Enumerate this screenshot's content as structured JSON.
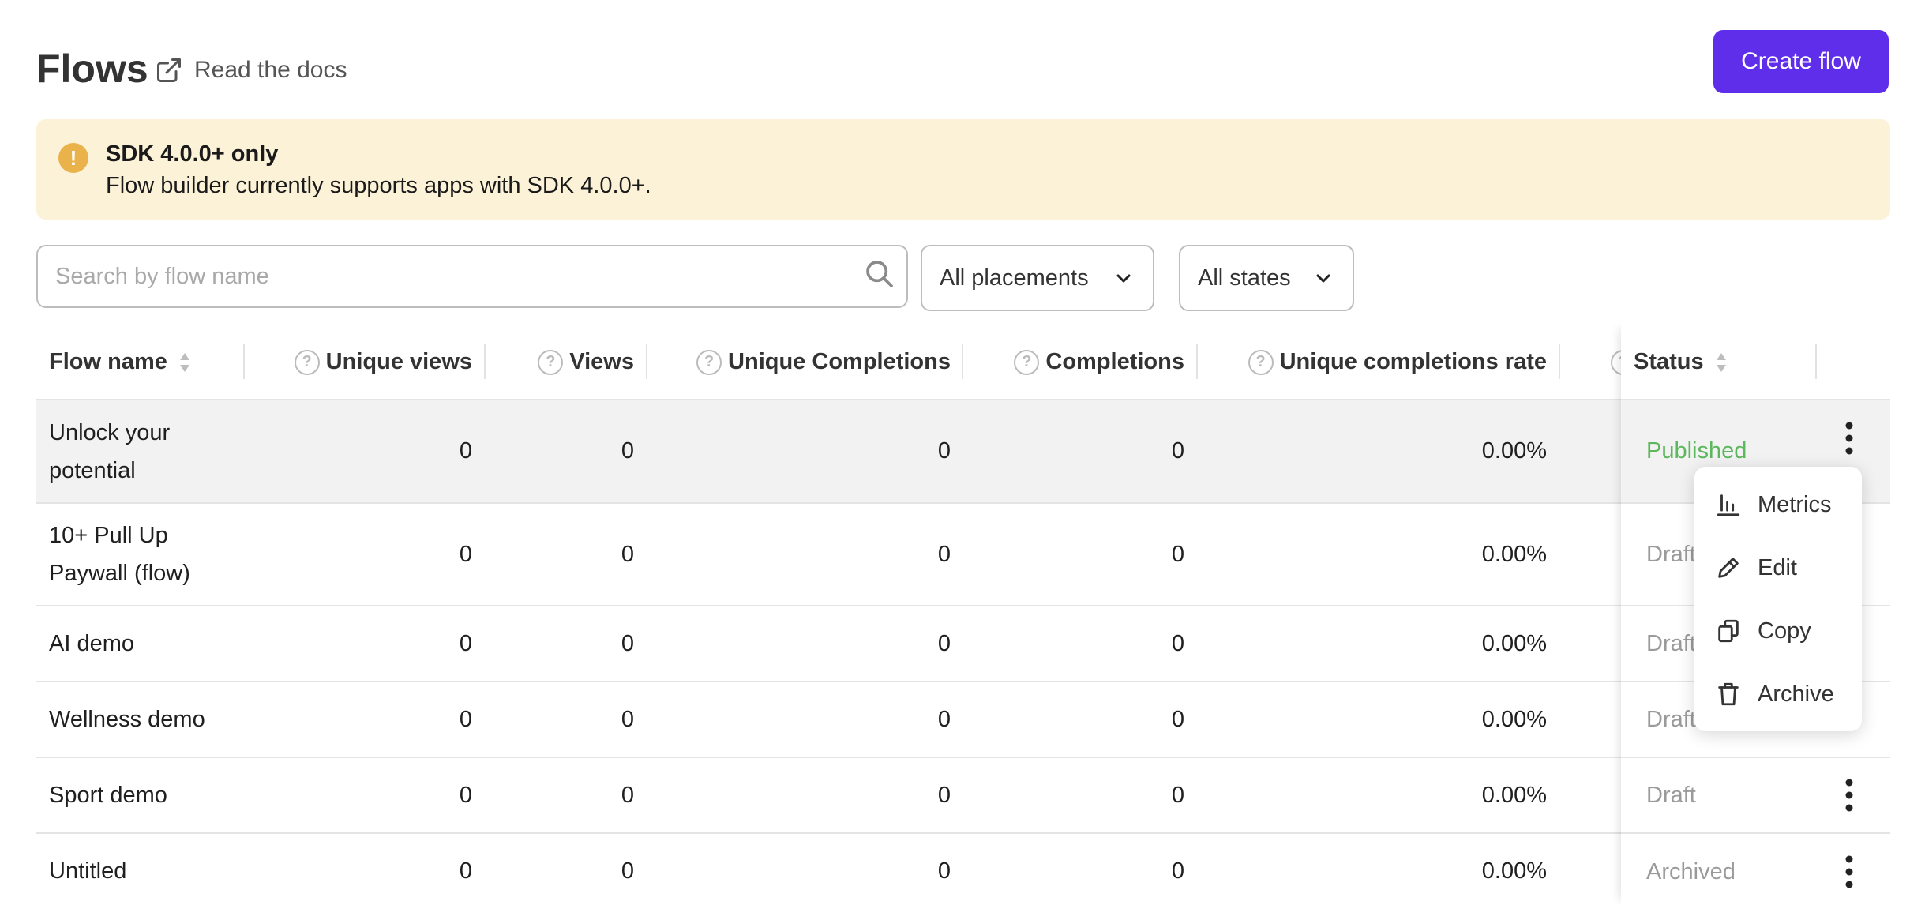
{
  "header": {
    "title": "Flows",
    "docs_label": "Read the docs",
    "create_label": "Create flow",
    "accent_color": "#5f2eea"
  },
  "banner": {
    "icon": "exclamation-icon",
    "title": "SDK 4.0.0+ only",
    "text": "Flow builder currently supports apps with SDK 4.0.0+."
  },
  "filters": {
    "search_placeholder": "Search by flow name",
    "placements_label": "All placements",
    "states_label": "All states"
  },
  "table": {
    "columns": {
      "name": "Flow name",
      "unique_views": "Unique views",
      "views": "Views",
      "unique_completions": "Unique Completions",
      "completions": "Completions",
      "unique_completions_rate": "Unique completions rate",
      "status": "Status"
    },
    "rows": [
      {
        "name": "Unlock your potential",
        "unique_views": "0",
        "views": "0",
        "unique_completions": "0",
        "completions": "0",
        "rate": "0.00%",
        "status": "Published"
      },
      {
        "name": "10+ Pull Up Paywall (flow)",
        "unique_views": "0",
        "views": "0",
        "unique_completions": "0",
        "completions": "0",
        "rate": "0.00%",
        "status": "Draft"
      },
      {
        "name": "AI demo",
        "unique_views": "0",
        "views": "0",
        "unique_completions": "0",
        "completions": "0",
        "rate": "0.00%",
        "status": "Draft"
      },
      {
        "name": "Wellness demo",
        "unique_views": "0",
        "views": "0",
        "unique_completions": "0",
        "completions": "0",
        "rate": "0.00%",
        "status": "Draft"
      },
      {
        "name": "Sport demo",
        "unique_views": "0",
        "views": "0",
        "unique_completions": "0",
        "completions": "0",
        "rate": "0.00%",
        "status": "Draft"
      },
      {
        "name": "Untitled",
        "unique_views": "0",
        "views": "0",
        "unique_completions": "0",
        "completions": "0",
        "rate": "0.00%",
        "status": "Archived"
      }
    ]
  },
  "menu": {
    "items": [
      {
        "label": "Metrics",
        "icon": "bar-chart-icon"
      },
      {
        "label": "Edit",
        "icon": "pencil-icon"
      },
      {
        "label": "Copy",
        "icon": "copy-icon"
      },
      {
        "label": "Archive",
        "icon": "trash-icon"
      }
    ]
  },
  "colors": {
    "published": "#5cb85c",
    "draft": "#9a9a9a",
    "banner_bg": "#fcf2d7",
    "banner_icon": "#e9b24a"
  }
}
